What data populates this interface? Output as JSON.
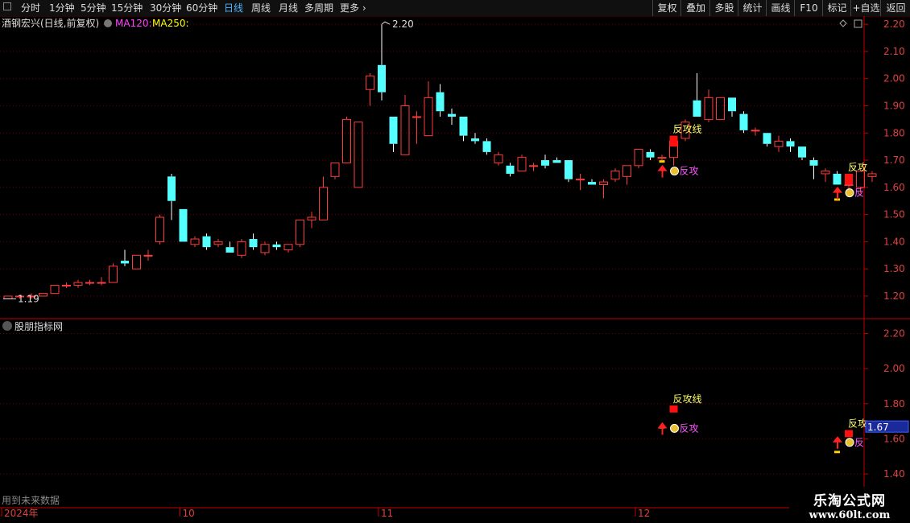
{
  "toolbar": {
    "left": [
      {
        "label": "分时",
        "active": false
      },
      {
        "label": "1分钟",
        "active": false
      },
      {
        "label": "5分钟",
        "active": false
      },
      {
        "label": "15分钟",
        "active": false
      },
      {
        "label": "30分钟",
        "active": false
      },
      {
        "label": "60分钟",
        "active": false
      },
      {
        "label": "日线",
        "active": true
      },
      {
        "label": "周线",
        "active": false
      },
      {
        "label": "月线",
        "active": false
      },
      {
        "label": "多周期",
        "active": false
      },
      {
        "label": "更多",
        "active": false
      }
    ],
    "right": [
      "复权",
      "叠加",
      "多股",
      "统计",
      "画线",
      "F10",
      "标记",
      "+自选",
      "返回"
    ]
  },
  "main_panel": {
    "stock_title": "酒钢宏兴(日线,前复权)",
    "ma120_label": "MA120:",
    "ma250_label": "MA250:",
    "max_label": "2.20",
    "min_label": "1.19"
  },
  "sub_panel": {
    "title": "股朋指标网",
    "current_value": "1.67",
    "footer_text": "用到未来数据"
  },
  "signals": {
    "line_label": "反攻线",
    "attack_label": "反攻",
    "short_label": "反"
  },
  "watermark": {
    "line1": "乐淘公式网",
    "line2": "www.60lt.com"
  },
  "colors": {
    "up": "#ff3c3c",
    "down": "#54ffff",
    "grid": "#6e0000",
    "axis": "#c40000",
    "ma120": "#ff44ff",
    "ma250": "#ffff00",
    "signal_red": "#ff1010",
    "text_yellow": "#ffff66",
    "text_magenta": "#ff55ff"
  },
  "chart_data": [
    {
      "type": "candlestick",
      "title": "酒钢宏兴(日线,前复权)",
      "ylim": [
        1.12,
        2.23
      ],
      "yticks": [
        1.2,
        1.3,
        1.4,
        1.5,
        1.6,
        1.7,
        1.8,
        1.9,
        2.0,
        2.1,
        2.2
      ],
      "xtick_labels": [
        "2024年",
        "10",
        "11",
        "12"
      ],
      "xtick_index": [
        0,
        15,
        32,
        54
      ],
      "candles": [
        {
          "o": 1.19,
          "h": 1.2,
          "l": 1.19,
          "c": 1.2
        },
        {
          "o": 1.2,
          "h": 1.2,
          "l": 1.19,
          "c": 1.2
        },
        {
          "o": 1.2,
          "h": 1.21,
          "l": 1.19,
          "c": 1.2
        },
        {
          "o": 1.2,
          "h": 1.21,
          "l": 1.2,
          "c": 1.21
        },
        {
          "o": 1.21,
          "h": 1.24,
          "l": 1.21,
          "c": 1.24
        },
        {
          "o": 1.24,
          "h": 1.25,
          "l": 1.23,
          "c": 1.24
        },
        {
          "o": 1.24,
          "h": 1.26,
          "l": 1.23,
          "c": 1.25
        },
        {
          "o": 1.25,
          "h": 1.26,
          "l": 1.24,
          "c": 1.25
        },
        {
          "o": 1.25,
          "h": 1.27,
          "l": 1.24,
          "c": 1.25
        },
        {
          "o": 1.25,
          "h": 1.32,
          "l": 1.25,
          "c": 1.31
        },
        {
          "o": 1.33,
          "h": 1.37,
          "l": 1.31,
          "c": 1.32
        },
        {
          "o": 1.3,
          "h": 1.35,
          "l": 1.3,
          "c": 1.35
        },
        {
          "o": 1.35,
          "h": 1.37,
          "l": 1.33,
          "c": 1.35
        },
        {
          "o": 1.4,
          "h": 1.5,
          "l": 1.39,
          "c": 1.49
        },
        {
          "o": 1.64,
          "h": 1.65,
          "l": 1.48,
          "c": 1.55
        },
        {
          "o": 1.52,
          "h": 1.52,
          "l": 1.4,
          "c": 1.4
        },
        {
          "o": 1.39,
          "h": 1.42,
          "l": 1.38,
          "c": 1.41
        },
        {
          "o": 1.42,
          "h": 1.43,
          "l": 1.37,
          "c": 1.38
        },
        {
          "o": 1.39,
          "h": 1.41,
          "l": 1.38,
          "c": 1.4
        },
        {
          "o": 1.38,
          "h": 1.4,
          "l": 1.36,
          "c": 1.36
        },
        {
          "o": 1.35,
          "h": 1.41,
          "l": 1.34,
          "c": 1.4
        },
        {
          "o": 1.41,
          "h": 1.43,
          "l": 1.37,
          "c": 1.38
        },
        {
          "o": 1.36,
          "h": 1.4,
          "l": 1.35,
          "c": 1.39
        },
        {
          "o": 1.39,
          "h": 1.4,
          "l": 1.37,
          "c": 1.38
        },
        {
          "o": 1.37,
          "h": 1.39,
          "l": 1.36,
          "c": 1.39
        },
        {
          "o": 1.39,
          "h": 1.48,
          "l": 1.38,
          "c": 1.48
        },
        {
          "o": 1.48,
          "h": 1.51,
          "l": 1.45,
          "c": 1.49
        },
        {
          "o": 1.48,
          "h": 1.64,
          "l": 1.48,
          "c": 1.6
        },
        {
          "o": 1.64,
          "h": 1.69,
          "l": 1.63,
          "c": 1.69
        },
        {
          "o": 1.69,
          "h": 1.86,
          "l": 1.69,
          "c": 1.85
        },
        {
          "o": 1.6,
          "h": 1.84,
          "l": 1.6,
          "c": 1.84
        },
        {
          "o": 1.96,
          "h": 2.02,
          "l": 1.9,
          "c": 2.01
        },
        {
          "o": 2.05,
          "h": 2.2,
          "l": 1.92,
          "c": 1.95
        },
        {
          "o": 1.86,
          "h": 1.86,
          "l": 1.73,
          "c": 1.76
        },
        {
          "o": 1.72,
          "h": 1.94,
          "l": 1.72,
          "c": 1.9
        },
        {
          "o": 1.86,
          "h": 1.88,
          "l": 1.76,
          "c": 1.86
        },
        {
          "o": 1.79,
          "h": 1.99,
          "l": 1.79,
          "c": 1.93
        },
        {
          "o": 1.95,
          "h": 1.98,
          "l": 1.86,
          "c": 1.88
        },
        {
          "o": 1.87,
          "h": 1.89,
          "l": 1.83,
          "c": 1.86
        },
        {
          "o": 1.86,
          "h": 1.86,
          "l": 1.77,
          "c": 1.79
        },
        {
          "o": 1.78,
          "h": 1.8,
          "l": 1.76,
          "c": 1.77
        },
        {
          "o": 1.77,
          "h": 1.78,
          "l": 1.72,
          "c": 1.73
        },
        {
          "o": 1.69,
          "h": 1.73,
          "l": 1.68,
          "c": 1.72
        },
        {
          "o": 1.68,
          "h": 1.69,
          "l": 1.64,
          "c": 1.65
        },
        {
          "o": 1.66,
          "h": 1.72,
          "l": 1.66,
          "c": 1.71
        },
        {
          "o": 1.68,
          "h": 1.69,
          "l": 1.66,
          "c": 1.68
        },
        {
          "o": 1.7,
          "h": 1.72,
          "l": 1.67,
          "c": 1.68
        },
        {
          "o": 1.7,
          "h": 1.71,
          "l": 1.69,
          "c": 1.69
        },
        {
          "o": 1.7,
          "h": 1.7,
          "l": 1.62,
          "c": 1.63
        },
        {
          "o": 1.63,
          "h": 1.65,
          "l": 1.59,
          "c": 1.63
        },
        {
          "o": 1.62,
          "h": 1.63,
          "l": 1.61,
          "c": 1.61
        },
        {
          "o": 1.61,
          "h": 1.63,
          "l": 1.56,
          "c": 1.62
        },
        {
          "o": 1.63,
          "h": 1.67,
          "l": 1.62,
          "c": 1.66
        },
        {
          "o": 1.64,
          "h": 1.68,
          "l": 1.61,
          "c": 1.68
        },
        {
          "o": 1.68,
          "h": 1.74,
          "l": 1.67,
          "c": 1.74
        },
        {
          "o": 1.73,
          "h": 1.74,
          "l": 1.7,
          "c": 1.71
        },
        {
          "o": 1.71,
          "h": 1.72,
          "l": 1.7,
          "c": 1.71
        },
        {
          "o": 1.71,
          "h": 1.77,
          "l": 1.68,
          "c": 1.77
        },
        {
          "o": 1.78,
          "h": 1.85,
          "l": 1.77,
          "c": 1.84
        },
        {
          "o": 1.92,
          "h": 2.02,
          "l": 1.86,
          "c": 1.86
        },
        {
          "o": 1.85,
          "h": 1.96,
          "l": 1.84,
          "c": 1.93
        },
        {
          "o": 1.85,
          "h": 1.93,
          "l": 1.85,
          "c": 1.93
        },
        {
          "o": 1.93,
          "h": 1.93,
          "l": 1.86,
          "c": 1.88
        },
        {
          "o": 1.87,
          "h": 1.88,
          "l": 1.8,
          "c": 1.81
        },
        {
          "o": 1.81,
          "h": 1.82,
          "l": 1.79,
          "c": 1.81
        },
        {
          "o": 1.8,
          "h": 1.8,
          "l": 1.75,
          "c": 1.76
        },
        {
          "o": 1.75,
          "h": 1.79,
          "l": 1.73,
          "c": 1.77
        },
        {
          "o": 1.77,
          "h": 1.78,
          "l": 1.73,
          "c": 1.75
        },
        {
          "o": 1.75,
          "h": 1.75,
          "l": 1.7,
          "c": 1.71
        },
        {
          "o": 1.7,
          "h": 1.71,
          "l": 1.63,
          "c": 1.68
        },
        {
          "o": 1.65,
          "h": 1.67,
          "l": 1.62,
          "c": 1.66
        },
        {
          "o": 1.65,
          "h": 1.66,
          "l": 1.61,
          "c": 1.61
        },
        {
          "o": 1.61,
          "h": 1.62,
          "l": 1.58,
          "c": 1.61
        },
        {
          "o": 1.6,
          "h": 1.67,
          "l": 1.58,
          "c": 1.66
        },
        {
          "o": 1.64,
          "h": 1.66,
          "l": 1.62,
          "c": 1.65
        }
      ],
      "signals": [
        {
          "index": 57,
          "line_bar": [
            1.75,
            1.79
          ],
          "arrow_price": 1.66,
          "label": "反攻线",
          "sub_label": "反攻"
        },
        {
          "index": 72,
          "line_bar": [
            1.61,
            1.65
          ],
          "arrow_price": 1.58,
          "label": "反攻",
          "sub_label": "反"
        }
      ]
    },
    {
      "type": "indicator",
      "title": "股朋指标网",
      "ylim": [
        1.35,
        2.28
      ],
      "yticks": [
        1.4,
        1.6,
        1.8,
        2.0,
        2.2
      ],
      "current_value": 1.67,
      "signals": [
        {
          "index": 57,
          "line_bar": [
            1.75,
            1.79
          ],
          "arrow_price": 1.66,
          "label": "反攻线",
          "sub_label": "反攻"
        },
        {
          "index": 72,
          "line_bar": [
            1.61,
            1.65
          ],
          "arrow_price": 1.58,
          "label": "反攻",
          "sub_label": "反"
        }
      ]
    }
  ]
}
